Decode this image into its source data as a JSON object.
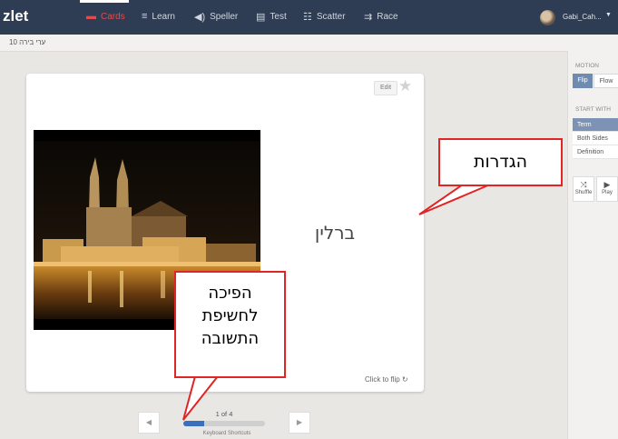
{
  "nav": {
    "logo": "zlet",
    "items": [
      {
        "label": "Cards",
        "icon": "cards-icon",
        "glyph": "▬",
        "active": true
      },
      {
        "label": "Learn",
        "icon": "learn-icon",
        "glyph": "≡"
      },
      {
        "label": "Speller",
        "icon": "speaker-icon",
        "glyph": "◀)"
      },
      {
        "label": "Test",
        "icon": "document-icon",
        "glyph": "▤"
      },
      {
        "label": "Scatter",
        "icon": "scatter-icon",
        "glyph": "☷"
      },
      {
        "label": "Race",
        "icon": "race-icon",
        "glyph": "⇉"
      }
    ],
    "username": "Gabi_Cah...",
    "caret": "▼"
  },
  "breadcrumb": "ערי בירה 10",
  "card": {
    "edit_label": "Edit",
    "star": "★",
    "term": "ברלין",
    "click_to_flip": "Click to flip ↻"
  },
  "side_panel": {
    "motion_heading": "MOTION",
    "flip_label": "Flip",
    "flow_label": "Flow",
    "start_with_heading": "START WITH",
    "options": [
      "Term",
      "Both Sides",
      "Definition"
    ],
    "selected_option": "Term",
    "shuffle_icon": "⤨",
    "shuffle_label": "Shuffle",
    "play_icon": "▶",
    "play_label": "Play"
  },
  "pager": {
    "prev": "◀",
    "next": "▶",
    "counter": "1 of 4",
    "progress": 0.25,
    "keyboard_shortcuts": "Keyboard Shortcuts"
  },
  "callouts": {
    "settings": "הגדרות",
    "flip_lines": [
      "הפיכה",
      "לחשיפת",
      "התשובה"
    ]
  },
  "colors": {
    "nav_bg": "#2f3d54",
    "accent_red": "#e24b4b",
    "progress_blue": "#3a6fbf",
    "callout_red": "#e12424"
  }
}
